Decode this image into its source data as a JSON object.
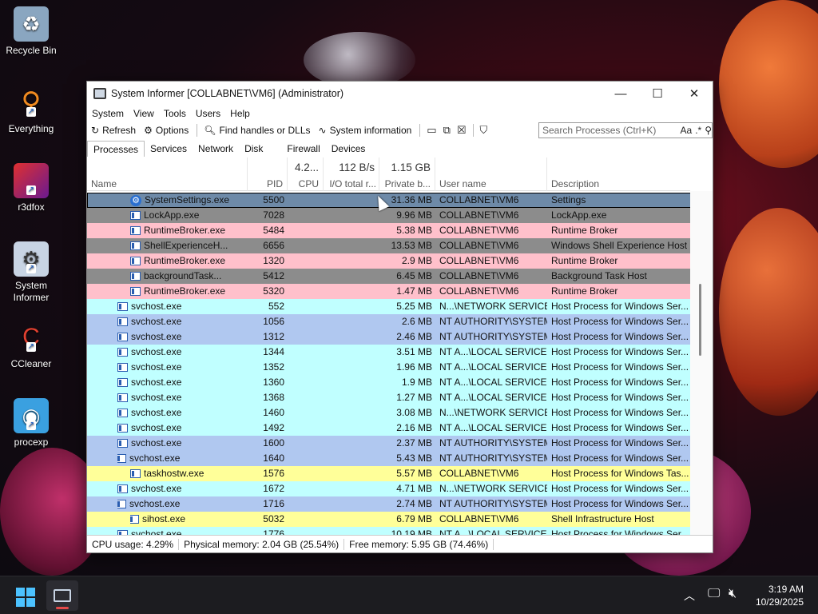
{
  "desktop": {
    "icons": [
      {
        "label": "Recycle Bin",
        "icon": "recycle-bin-icon"
      },
      {
        "label": "Everything",
        "icon": "everything-search-icon"
      },
      {
        "label": "r3dfox",
        "icon": "r3dfox-browser-icon"
      },
      {
        "label": "System\nInformer",
        "icon": "system-informer-icon"
      },
      {
        "label": "CCleaner",
        "icon": "ccleaner-icon"
      },
      {
        "label": "procexp",
        "icon": "procexp-icon"
      }
    ]
  },
  "window": {
    "title": "System Informer [COLLABNET\\VM6] (Administrator)",
    "controls": {
      "minimize": "—",
      "maximize": "☐",
      "close": "✕"
    }
  },
  "menu": [
    "System",
    "View",
    "Tools",
    "Users",
    "Help"
  ],
  "toolbar": {
    "refresh": "Refresh",
    "options": "Options",
    "find": "Find handles or DLLs",
    "sysinfo": "System information"
  },
  "search": {
    "placeholder": "Search Processes (Ctrl+K)",
    "case_label": "Aa",
    "regex_label": ".*"
  },
  "tabs": [
    "Processes",
    "Services",
    "Network",
    "Disk",
    "Firewall",
    "Devices"
  ],
  "columns": {
    "name": "Name",
    "pid": "PID",
    "cpu": "CPU",
    "io": "I/O total r...",
    "private": "Private b...",
    "user": "User name",
    "desc": "Description",
    "cpu_total": "4.2...",
    "io_total": "112 B/s",
    "private_total": "1.15 GB"
  },
  "processes": [
    {
      "name": "SystemSettings.exe",
      "pid": "5500",
      "private": "31.36 MB",
      "user": "COLLABNET\\VM6",
      "desc": "Settings",
      "color": "#6e8aa8",
      "indent": 2,
      "arrow": "",
      "icon": "gear",
      "selected": true
    },
    {
      "name": "LockApp.exe",
      "pid": "7028",
      "private": "9.96 MB",
      "user": "COLLABNET\\VM6",
      "desc": "LockApp.exe",
      "color": "#8c8c8c",
      "indent": 2,
      "arrow": "",
      "icon": "proc"
    },
    {
      "name": "RuntimeBroker.exe",
      "pid": "5484",
      "private": "5.38 MB",
      "user": "COLLABNET\\VM6",
      "desc": "Runtime Broker",
      "color": "#ffc0cb",
      "indent": 2,
      "arrow": "",
      "icon": "proc"
    },
    {
      "name": "ShellExperienceH...",
      "pid": "6656",
      "private": "13.53 MB",
      "user": "COLLABNET\\VM6",
      "desc": "Windows Shell Experience Host",
      "color": "#8c8c8c",
      "indent": 2,
      "arrow": "",
      "icon": "proc"
    },
    {
      "name": "RuntimeBroker.exe",
      "pid": "1320",
      "private": "2.9 MB",
      "user": "COLLABNET\\VM6",
      "desc": "Runtime Broker",
      "color": "#ffc0cb",
      "indent": 2,
      "arrow": "",
      "icon": "proc"
    },
    {
      "name": "backgroundTask...",
      "pid": "5412",
      "private": "6.45 MB",
      "user": "COLLABNET\\VM6",
      "desc": "Background Task Host",
      "color": "#8c8c8c",
      "indent": 2,
      "arrow": "",
      "icon": "proc"
    },
    {
      "name": "RuntimeBroker.exe",
      "pid": "5320",
      "private": "1.47 MB",
      "user": "COLLABNET\\VM6",
      "desc": "Runtime Broker",
      "color": "#ffc0cb",
      "indent": 2,
      "arrow": "",
      "icon": "proc"
    },
    {
      "name": "svchost.exe",
      "pid": "552",
      "private": "5.25 MB",
      "user": "N...\\NETWORK SERVICE",
      "desc": "Host Process for Windows Ser...",
      "color": "#c0ffff",
      "indent": 1,
      "arrow": "",
      "icon": "proc"
    },
    {
      "name": "svchost.exe",
      "pid": "1056",
      "private": "2.6 MB",
      "user": "NT AUTHORITY\\SYSTEM",
      "desc": "Host Process for Windows Ser...",
      "color": "#b0c8f0",
      "indent": 1,
      "arrow": "",
      "icon": "proc"
    },
    {
      "name": "svchost.exe",
      "pid": "1312",
      "private": "2.46 MB",
      "user": "NT AUTHORITY\\SYSTEM",
      "desc": "Host Process for Windows Ser...",
      "color": "#b0c8f0",
      "indent": 1,
      "arrow": "",
      "icon": "proc"
    },
    {
      "name": "svchost.exe",
      "pid": "1344",
      "private": "3.51 MB",
      "user": "NT A...\\LOCAL SERVICE",
      "desc": "Host Process for Windows Ser...",
      "color": "#c0ffff",
      "indent": 1,
      "arrow": "",
      "icon": "proc"
    },
    {
      "name": "svchost.exe",
      "pid": "1352",
      "private": "1.96 MB",
      "user": "NT A...\\LOCAL SERVICE",
      "desc": "Host Process for Windows Ser...",
      "color": "#c0ffff",
      "indent": 1,
      "arrow": "",
      "icon": "proc"
    },
    {
      "name": "svchost.exe",
      "pid": "1360",
      "private": "1.9 MB",
      "user": "NT A...\\LOCAL SERVICE",
      "desc": "Host Process for Windows Ser...",
      "color": "#c0ffff",
      "indent": 1,
      "arrow": "",
      "icon": "proc"
    },
    {
      "name": "svchost.exe",
      "pid": "1368",
      "private": "1.27 MB",
      "user": "NT A...\\LOCAL SERVICE",
      "desc": "Host Process for Windows Ser...",
      "color": "#c0ffff",
      "indent": 1,
      "arrow": "",
      "icon": "proc"
    },
    {
      "name": "svchost.exe",
      "pid": "1460",
      "private": "3.08 MB",
      "user": "N...\\NETWORK SERVICE",
      "desc": "Host Process for Windows Ser...",
      "color": "#c0ffff",
      "indent": 1,
      "arrow": "",
      "icon": "proc"
    },
    {
      "name": "svchost.exe",
      "pid": "1492",
      "private": "2.16 MB",
      "user": "NT A...\\LOCAL SERVICE",
      "desc": "Host Process for Windows Ser...",
      "color": "#c0ffff",
      "indent": 1,
      "arrow": "",
      "icon": "proc"
    },
    {
      "name": "svchost.exe",
      "pid": "1600",
      "private": "2.37 MB",
      "user": "NT AUTHORITY\\SYSTEM",
      "desc": "Host Process for Windows Ser...",
      "color": "#b0c8f0",
      "indent": 1,
      "arrow": "",
      "icon": "proc"
    },
    {
      "name": "svchost.exe",
      "pid": "1640",
      "private": "5.43 MB",
      "user": "NT AUTHORITY\\SYSTEM",
      "desc": "Host Process for Windows Ser...",
      "color": "#b0c8f0",
      "indent": 1,
      "arrow": "⌄",
      "icon": "proc"
    },
    {
      "name": "taskhostw.exe",
      "pid": "1576",
      "private": "5.57 MB",
      "user": "COLLABNET\\VM6",
      "desc": "Host Process for Windows Tas...",
      "color": "#ffff99",
      "indent": 2,
      "arrow": "",
      "icon": "proc"
    },
    {
      "name": "svchost.exe",
      "pid": "1672",
      "private": "4.71 MB",
      "user": "N...\\NETWORK SERVICE",
      "desc": "Host Process for Windows Ser...",
      "color": "#c0ffff",
      "indent": 1,
      "arrow": "",
      "icon": "proc"
    },
    {
      "name": "svchost.exe",
      "pid": "1716",
      "private": "2.74 MB",
      "user": "NT AUTHORITY\\SYSTEM",
      "desc": "Host Process for Windows Ser...",
      "color": "#b0c8f0",
      "indent": 1,
      "arrow": "⌄",
      "icon": "proc"
    },
    {
      "name": "sihost.exe",
      "pid": "5032",
      "private": "6.79 MB",
      "user": "COLLABNET\\VM6",
      "desc": "Shell Infrastructure Host",
      "color": "#ffff99",
      "indent": 2,
      "arrow": "›",
      "icon": "proc"
    },
    {
      "name": "svchost.exe",
      "pid": "1776",
      "private": "10.19 MB",
      "user": "NT A...\\LOCAL SERVICE",
      "desc": "Host Process for Windows Ser...",
      "color": "#c0ffff",
      "indent": 1,
      "arrow": "",
      "icon": "proc"
    }
  ],
  "status": {
    "cpu": "CPU usage: 4.29%",
    "physical": "Physical memory: 2.04 GB (25.54%)",
    "free": "Free memory: 5.95 GB (74.46%)"
  },
  "taskbar": {
    "time": "3:19 AM",
    "date": "10/29/2025",
    "start_color": "#4cc2ff"
  }
}
